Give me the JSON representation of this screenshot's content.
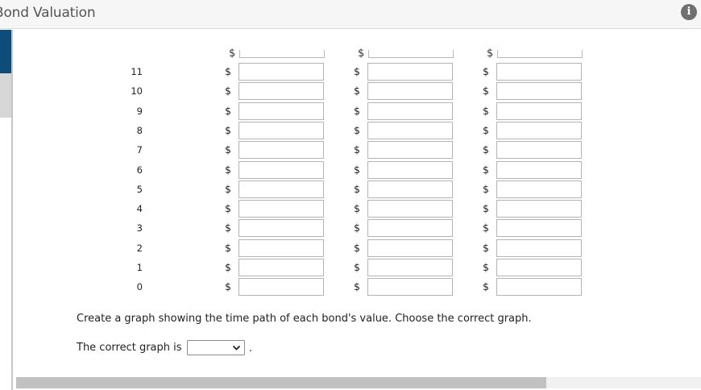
{
  "app": {
    "title": "Bond Valuation"
  },
  "icons": {
    "info": "info-icon",
    "dropdown": "chevron-down-icon"
  },
  "colors": {
    "nav_active": "#0e4c7a",
    "info_icon": "#707070"
  },
  "table": {
    "currency_symbol": "$",
    "columns": 3,
    "rows": [
      {
        "year": "11",
        "values": [
          "",
          "",
          ""
        ]
      },
      {
        "year": "10",
        "values": [
          "",
          "",
          ""
        ]
      },
      {
        "year": "9",
        "values": [
          "",
          "",
          ""
        ]
      },
      {
        "year": "8",
        "values": [
          "",
          "",
          ""
        ]
      },
      {
        "year": "7",
        "values": [
          "",
          "",
          ""
        ]
      },
      {
        "year": "6",
        "values": [
          "",
          "",
          ""
        ]
      },
      {
        "year": "5",
        "values": [
          "",
          "",
          ""
        ]
      },
      {
        "year": "4",
        "values": [
          "",
          "",
          ""
        ]
      },
      {
        "year": "3",
        "values": [
          "",
          "",
          ""
        ]
      },
      {
        "year": "2",
        "values": [
          "",
          "",
          ""
        ]
      },
      {
        "year": "1",
        "values": [
          "",
          "",
          ""
        ]
      },
      {
        "year": "0",
        "values": [
          "",
          "",
          ""
        ]
      }
    ]
  },
  "question": {
    "instruction": "Create a graph showing the time path of each bond's value. Choose the correct graph.",
    "answer_label": "The correct graph is",
    "answer_value": "",
    "answer_suffix": "."
  }
}
